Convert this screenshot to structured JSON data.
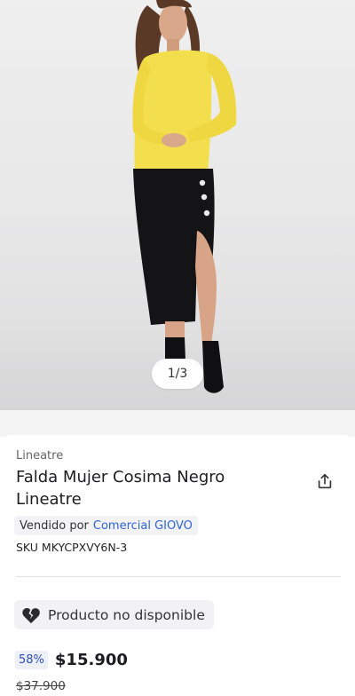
{
  "gallery": {
    "counter": "1/3"
  },
  "product": {
    "brand": "Lineatre",
    "title": "Falda Mujer Cosima Negro Lineatre",
    "seller_label": "Vendido por",
    "seller_name": "Comercial GIOVO",
    "sku": "SKU MKYCPXVY6N-3",
    "availability": "Producto no disponible",
    "discount": "58%",
    "price": "$15.900",
    "old_price": "$37.900"
  },
  "icons": {
    "share": "share-icon",
    "broken_heart": "broken-heart-icon"
  },
  "colors": {
    "seller_link": "#2d64d6",
    "discount_text": "#2d4fb6",
    "discount_bg": "#eef0f8"
  }
}
